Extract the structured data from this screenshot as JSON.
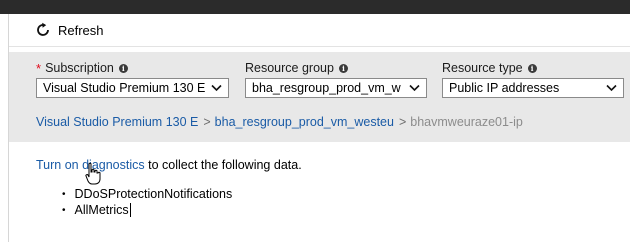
{
  "toolbar": {
    "refresh_label": "Refresh"
  },
  "filters": {
    "subscription": {
      "required_mark": "*",
      "label": "Subscription",
      "value": "Visual Studio Premium 130 E"
    },
    "resource_group": {
      "label": "Resource group",
      "value": "bha_resgroup_prod_vm_w"
    },
    "resource_type": {
      "label": "Resource type",
      "value": "Public IP addresses"
    }
  },
  "breadcrumb": {
    "subscription": "Visual Studio Premium 130 E",
    "separator": ">",
    "resource_group": "bha_resgroup_prod_vm_westeu",
    "resource": "bhavmweuraze01-ip"
  },
  "diagnostics": {
    "link_text": "Turn on diagnostics",
    "rest_text": " to collect the following data.",
    "items": [
      "DDoSProtectionNotifications",
      "AllMetrics"
    ]
  },
  "icons": {
    "refresh": "refresh-icon",
    "info": "info-icon",
    "dropdown": "chevron-down-icon",
    "cursor": "hand-cursor-icon"
  },
  "colors": {
    "link": "#1a5ba6",
    "required": "#e00b1c",
    "panel_bg": "#e8e8e8",
    "top_bar": "#2b2b2b"
  }
}
